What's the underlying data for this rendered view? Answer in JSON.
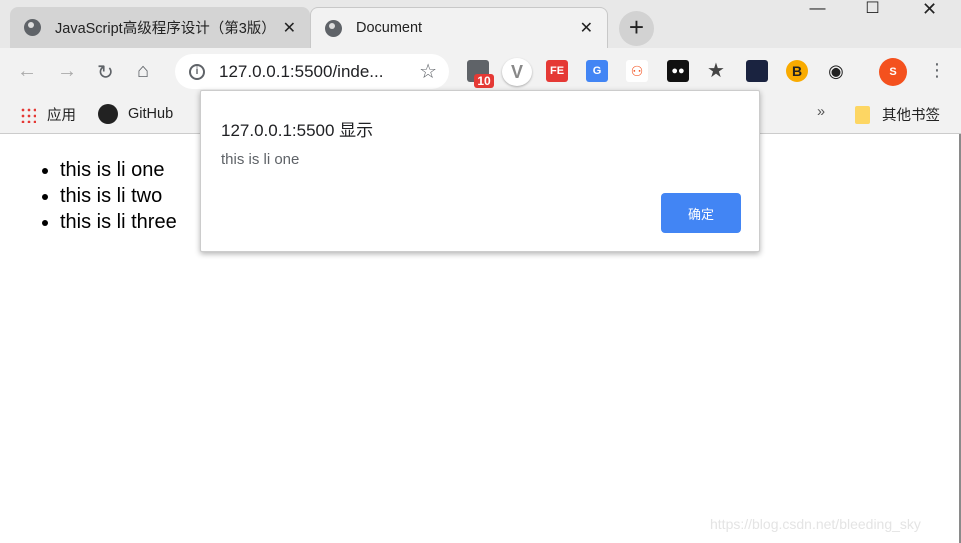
{
  "tabs": [
    {
      "title": "JavaScript高级程序设计（第3版）"
    },
    {
      "title": "Document",
      "active": true
    }
  ],
  "toolbar": {
    "url": "127.0.0.1:5500/inde...",
    "extension_badge": "10",
    "profile_initial": "S"
  },
  "bookmarks": {
    "apps": "应用",
    "github": "GitHub",
    "overflow": "»",
    "other": "其他书签"
  },
  "page": {
    "items": [
      "this is li one",
      "this is li two",
      "this is li three"
    ]
  },
  "dialog": {
    "title": "127.0.0.1:5500 显示",
    "message": "this is li one",
    "ok": "确定"
  },
  "watermark": "https://blog.csdn.net/bleeding_sky",
  "colors": {
    "accent": "#4285f4",
    "profile": "#f4511e"
  }
}
